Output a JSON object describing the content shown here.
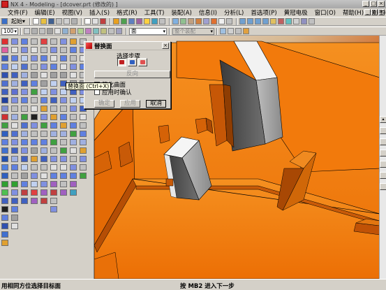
{
  "window": {
    "title": "NX 4 - Modeling - [dcover.prt (修改的) ]",
    "buttons": [
      "_",
      "□",
      "×"
    ]
  },
  "menubar": {
    "items": [
      "文件(F)",
      "编辑(E)",
      "视图(V)",
      "插入(S)",
      "格式(R)",
      "工具(T)",
      "装配(A)",
      "信息(I)",
      "分析(L)",
      "首选项(P)",
      "黄冠电极",
      "窗口(O)",
      "帮助(H)",
      "黄冠补充"
    ]
  },
  "toolbar1": {
    "start_label": "起始▾"
  },
  "toolbar2": {
    "zoom_value": "100",
    "filter_value": "面",
    "selection_value": "整个装配"
  },
  "dialog": {
    "title": "替换面",
    "steps_label": "选择步骤",
    "flip_label": "反向",
    "simplify_label": "简化曲面",
    "apply_confirm_label": "应用时确认",
    "ok_label": "确定",
    "apply_label": "应用",
    "cancel_label": "取消"
  },
  "tooltip": {
    "text": "替换面 (Ctrl+X)"
  },
  "status": {
    "left": "用相同方位选择目标面",
    "mid": "按 MB2 进入下一步"
  },
  "colors": {
    "model": "#f07a0a",
    "model_dark": "#b24e05",
    "gray_block": "#9a9a9a"
  }
}
